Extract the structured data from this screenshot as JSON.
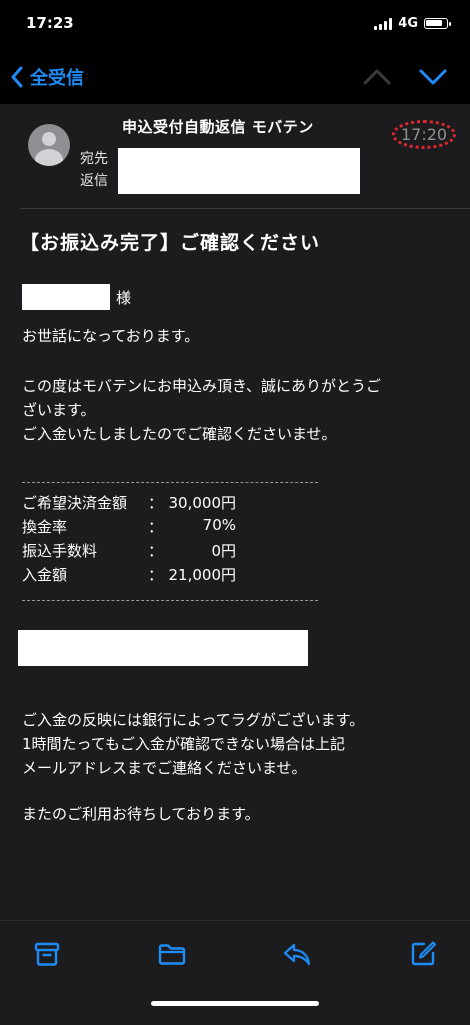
{
  "status_bar": {
    "time": "17:23",
    "network": "4G",
    "battery_level": 0.85
  },
  "nav": {
    "back_label": "全受信"
  },
  "header": {
    "sender": "申込受付自動返信 モバテン",
    "time": "17:20",
    "to_label": "宛先",
    "reply_label": "返信"
  },
  "email": {
    "subject": "【お振込み完了】ご確認ください",
    "salutation_suffix": "様",
    "greeting": "お世話になっております。",
    "intro_line1": "この度はモバテンにお申込み頂き、誠にありがとうご",
    "intro_line2": "ざいます。",
    "intro_line3": "ご入金いたしましたのでご確認くださいませ。",
    "details": [
      {
        "label": "ご希望決済金額",
        "value": "30,000円"
      },
      {
        "label": "換金率",
        "value": "70%"
      },
      {
        "label": "振込手数料",
        "value": "0円"
      },
      {
        "label": "入金額",
        "value": "21,000円"
      }
    ],
    "notice_line1": "ご入金の反映には銀行によってラグがございます。",
    "notice_line2": "1時間たってもご入金が確認できない場合は上記",
    "notice_line3": "メールアドレスまでご連絡くださいませ。",
    "closing": "またのご利用お待ちしております。"
  },
  "colors": {
    "accent": "#1e8cf6",
    "highlight": "#e0262f",
    "background": "#1c1c1e"
  },
  "icons": [
    "back-chevron-icon",
    "up-chevron-icon",
    "down-chevron-icon",
    "archive-icon",
    "folder-icon",
    "reply-icon",
    "compose-icon"
  ]
}
